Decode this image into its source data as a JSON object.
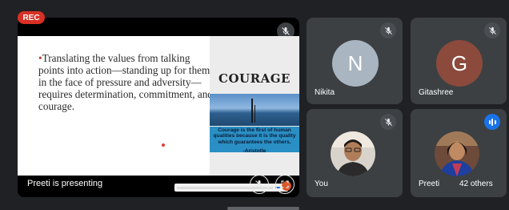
{
  "recording_badge": "REC",
  "presentation": {
    "slide_bullet": "•",
    "slide_text": "Translating the values from talking points into action—standing up for them in the face of  pressure and adversity—requires determination, commitment, and courage.",
    "side_title": "COURAGE",
    "quote": "Courage is the first of human qualities because it is the quality which guarantees the others.",
    "quote_author": "-Aristotle",
    "presenting_label": "Preeti is presenting"
  },
  "participants": {
    "nikita": {
      "initial": "N",
      "name": "Nikita",
      "avatar_color": "#a9b6c1"
    },
    "gitashree": {
      "initial": "G",
      "name": "Gitashree",
      "avatar_color": "#8b4a3c"
    },
    "you": {
      "name": "You"
    },
    "preeti": {
      "name": "Preeti"
    }
  },
  "others_count": "42 others",
  "icons": {
    "main_mute": "mic-off-icon",
    "tile_mute": "mic-off-icon",
    "speaking": "audio-level-icon",
    "fullscreen": "fullscreen-icon"
  },
  "colors": {
    "background": "#202124",
    "tile": "#3c4043",
    "recording": "#d93025",
    "speaking_indicator": "#1a73e8"
  }
}
